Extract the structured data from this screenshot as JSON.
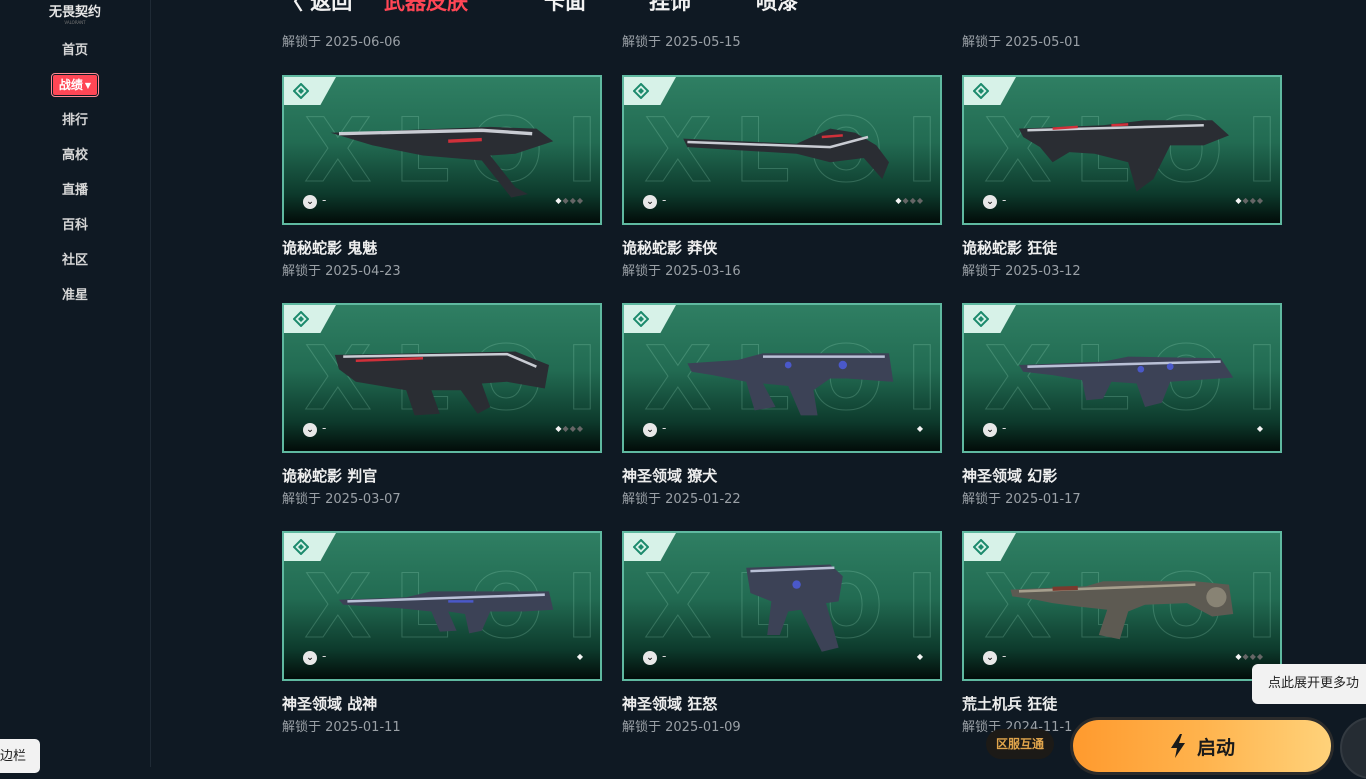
{
  "logo": {
    "title": "无畏契约",
    "subtitle": "VALORANT"
  },
  "sidebar": {
    "items": [
      {
        "label": "首页"
      },
      {
        "label": "战绩",
        "active": true
      },
      {
        "label": "排行"
      },
      {
        "label": "高校"
      },
      {
        "label": "直播"
      },
      {
        "label": "百科"
      },
      {
        "label": "社区"
      },
      {
        "label": "准星"
      }
    ]
  },
  "tabs": [
    {
      "label": "〈 返回"
    },
    {
      "label": "武器皮肤",
      "active": true
    },
    {
      "label": "卡面"
    },
    {
      "label": "挂饰"
    },
    {
      "label": "喷漆"
    }
  ],
  "top_dates": [
    "解锁于 2025-06-06",
    "解锁于 2025-05-15",
    "解锁于 2025-05-01"
  ],
  "watermark": "XLOI",
  "skins": [
    {
      "name": "诡秘蛇影 鬼魅",
      "date": "解锁于 2025-04-23",
      "tier_dots": 4,
      "tier_filled": 1,
      "style": "red"
    },
    {
      "name": "诡秘蛇影 莽侠",
      "date": "解锁于 2025-03-16",
      "tier_dots": 4,
      "tier_filled": 1,
      "style": "red"
    },
    {
      "name": "诡秘蛇影 狂徒",
      "date": "解锁于 2025-03-12",
      "tier_dots": 4,
      "tier_filled": 1,
      "style": "red"
    },
    {
      "name": "诡秘蛇影 判官",
      "date": "解锁于 2025-03-07",
      "tier_dots": 4,
      "tier_filled": 1,
      "style": "red"
    },
    {
      "name": "神圣领域 獠犬",
      "date": "解锁于 2025-01-22",
      "tier_dots": 1,
      "tier_filled": 1,
      "style": "blue"
    },
    {
      "name": "神圣领域 幻影",
      "date": "解锁于 2025-01-17",
      "tier_dots": 1,
      "tier_filled": 1,
      "style": "blue"
    },
    {
      "name": "神圣领域 战神",
      "date": "解锁于 2025-01-11",
      "tier_dots": 1,
      "tier_filled": 1,
      "style": "blue"
    },
    {
      "name": "神圣领域 狂怒",
      "date": "解锁于 2025-01-09",
      "tier_dots": 1,
      "tier_filled": 1,
      "style": "blue"
    },
    {
      "name": "荒土机兵 狂徒",
      "date": "解锁于 2024-11-1",
      "tier_dots": 4,
      "tier_filled": 1,
      "style": "rust"
    }
  ],
  "card_level_text": "-",
  "tooltip": "点此展开更多功",
  "region_badge": "区服互通",
  "launch_label": "启动",
  "edge_chip": "边栏",
  "colors": {
    "accent": "#ff4655",
    "card_border": "#5fb9a0",
    "launch": "#ffb34d"
  }
}
